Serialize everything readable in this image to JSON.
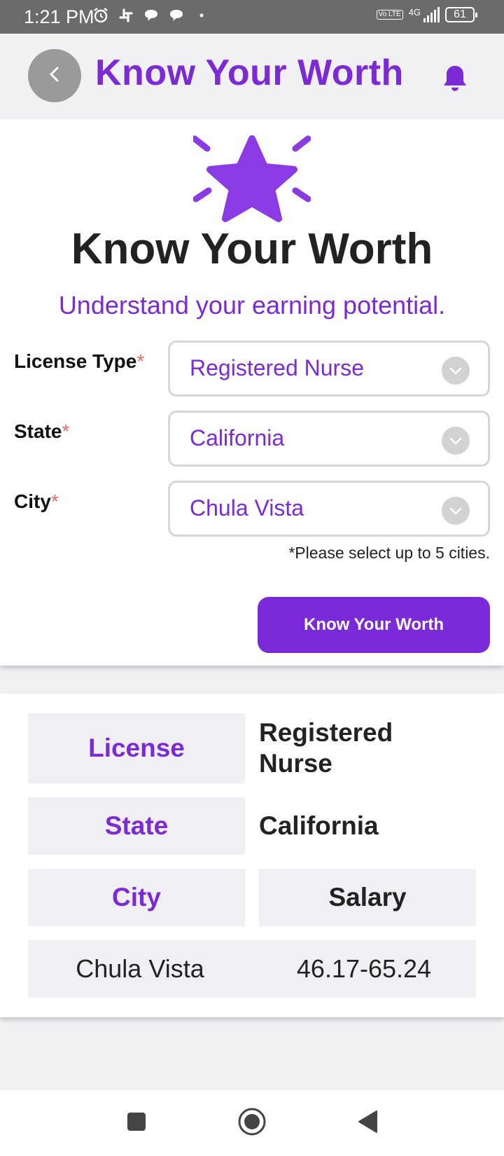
{
  "status_bar": {
    "time": "1:21 PM",
    "network": "4G",
    "volte": "Vo LTE",
    "battery": "61"
  },
  "appbar": {
    "title": "Know Your Worth",
    "back_icon": "chevron-left-icon",
    "notify_icon": "bell-icon"
  },
  "hero": {
    "icon": "star-icon",
    "title": "Know Your Worth",
    "subtitle": "Understand your earning potential."
  },
  "form": {
    "license_type": {
      "label": "License Type",
      "required_mark": "*",
      "value": "Registered Nurse"
    },
    "state": {
      "label": "State",
      "required_mark": "*",
      "value": "California"
    },
    "city": {
      "label": "City",
      "required_mark": "*",
      "value": "Chula Vista"
    },
    "hint": "*Please select up to 5 cities.",
    "submit_label": "Know Your Worth"
  },
  "results": {
    "license_label": "License",
    "license_value": "Registered Nurse",
    "state_label": "State",
    "state_value": "California",
    "city_header": "City",
    "salary_header": "Salary",
    "rows": [
      {
        "city": "Chula Vista",
        "salary": "46.17-65.24"
      }
    ]
  },
  "colors": {
    "accent": "#7b2ad6",
    "required": "#e86a6a",
    "cell_bg": "#f0f0f4"
  }
}
